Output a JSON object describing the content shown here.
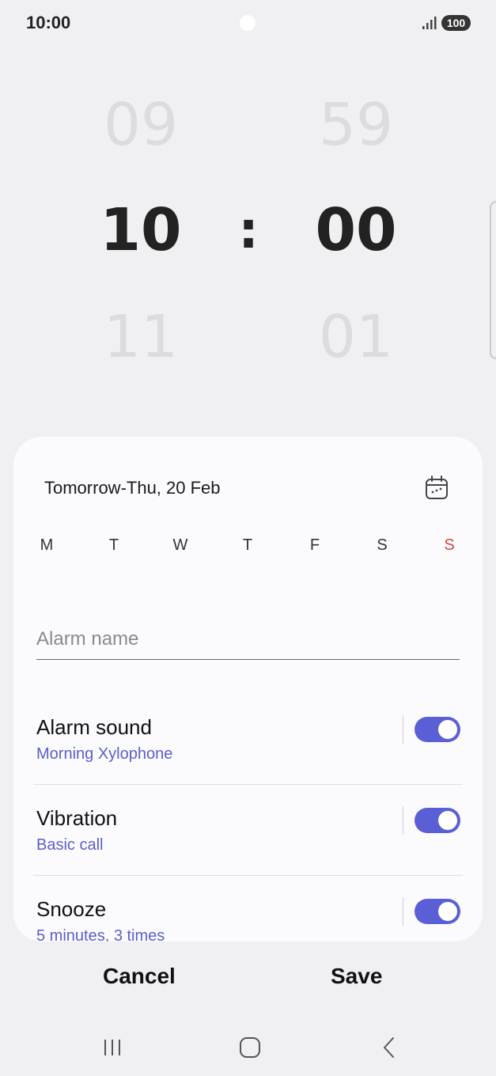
{
  "status_bar": {
    "time": "10:00",
    "battery": "100",
    "icons": [
      "camera-dot",
      "signal-icon",
      "battery-icon"
    ]
  },
  "time_picker": {
    "hour_prev": "09",
    "hour": "10",
    "hour_next": "11",
    "separator": ":",
    "minute_prev": "59",
    "minute": "00",
    "minute_next": "01"
  },
  "schedule": {
    "date_label": "Tomorrow-Thu, 20 Feb",
    "calendar_icon": "calendar-icon",
    "days": [
      {
        "label": "M"
      },
      {
        "label": "T"
      },
      {
        "label": "W"
      },
      {
        "label": "T"
      },
      {
        "label": "F"
      },
      {
        "label": "S"
      },
      {
        "label": "S"
      }
    ],
    "sunday_color": "#d6453f"
  },
  "alarm_name": {
    "placeholder": "Alarm name",
    "value": ""
  },
  "settings": [
    {
      "title": "Alarm sound",
      "subtitle": "Morning Xylophone",
      "enabled": true
    },
    {
      "title": "Vibration",
      "subtitle": "Basic call",
      "enabled": true
    },
    {
      "title": "Snooze",
      "subtitle": "5 minutes, 3 times",
      "enabled": true
    }
  ],
  "actions": {
    "cancel": "Cancel",
    "save": "Save"
  },
  "nav": {
    "icons": [
      "recents-icon",
      "home-icon",
      "back-icon"
    ]
  },
  "colors": {
    "accent": "#5b5fd6",
    "subtitle": "#5b5fc7",
    "background": "#f0f0f3",
    "card": "#fbfbfe"
  }
}
